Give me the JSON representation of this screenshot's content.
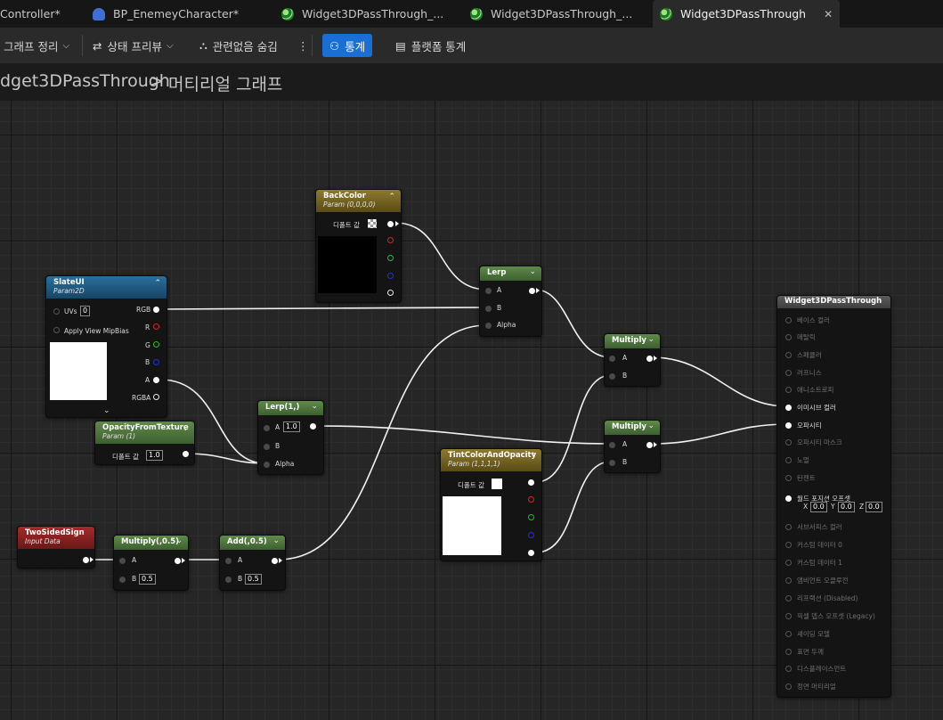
{
  "tabs": [
    {
      "label": "Controller*",
      "icon": "none"
    },
    {
      "label": "BP_EnemeyCharacter*",
      "icon": "blueprint-character-icon"
    },
    {
      "label": "Widget3DPassThrough_...",
      "icon": "material-icon"
    },
    {
      "label": "Widget3DPassThrough_...",
      "icon": "material-icon"
    },
    {
      "label": "Widget3DPassThrough",
      "icon": "material-icon",
      "active": true
    }
  ],
  "toolbar": {
    "graph_cleanup": "그래프 정리",
    "state_preview": "상태 프리뷰",
    "hide_unrelated": "관련없음 숨김",
    "stats": "통계",
    "platform_stats": "플랫폼 통계"
  },
  "breadcrumb": {
    "asset": "dget3DPassThrough",
    "separator": ">",
    "graph": "머티리얼 그래프"
  },
  "nodes": {
    "back_color": {
      "title": "BackColor",
      "subtitle": "Param (0,0,0,0)",
      "default_label": "디폴트 값"
    },
    "slate_ui": {
      "title": "SlateUI",
      "subtitle": "Param2D",
      "uvs": "UVs",
      "uvs_value": "0",
      "apply_view": "Apply View MipBias",
      "outputs": [
        "RGB",
        "R",
        "G",
        "B",
        "A",
        "RGBA"
      ]
    },
    "opacity_from_texture": {
      "title": "OpacityFromTexture",
      "subtitle": "Param (1)",
      "default_label": "디폴트 값",
      "value": "1.0"
    },
    "lerp_top": {
      "title": "Lerp",
      "inputs": [
        "A",
        "B",
        "Alpha"
      ]
    },
    "lerp_mid": {
      "title": "Lerp(1,)",
      "inputs": [
        "A",
        "B",
        "Alpha"
      ],
      "a_value": "1.0"
    },
    "multiply_top": {
      "title": "Multiply",
      "inputs": [
        "A",
        "B"
      ]
    },
    "multiply_mid": {
      "title": "Multiply",
      "inputs": [
        "A",
        "B"
      ]
    },
    "tint": {
      "title": "TintColorAndOpacity",
      "subtitle": "Param (1,1,1,1)",
      "default_label": "디폴트 값"
    },
    "two_sided": {
      "title": "TwoSidedSign",
      "subtitle": "Input Data"
    },
    "multiply_half": {
      "title": "Multiply(,0.5)",
      "inputs": [
        "A",
        "B"
      ],
      "b_value": "0.5"
    },
    "add_half": {
      "title": "Add(,0.5)",
      "inputs": [
        "A",
        "B"
      ],
      "b_value": "0.5"
    },
    "result": {
      "title": "Widget3DPassThrough",
      "pins": [
        "베이스 컬러",
        "메탈릭",
        "스페큘러",
        "러프니스",
        "애니소트로피",
        "이미시브 컬러",
        "오파시티",
        "오파시티 마스크",
        "노멀",
        "탄젠트",
        "월드 포지션 오프셋",
        "서브서피스 컬러",
        "커스텀 데이터 0",
        "커스텀 데이터 1",
        "앰비언트 오클루전",
        "리프랙션 (Disabled)",
        "픽셀 뎁스 오프셋 (Legacy)",
        "셰이딩 모델",
        "표면 두께",
        "디스플레이스먼트",
        "정면 머티리얼"
      ],
      "active_pins": [
        5,
        6,
        10
      ],
      "wpo": {
        "x_label": "X",
        "x": "0.0",
        "y_label": "Y",
        "y": "0.0",
        "z_label": "Z",
        "z": "0.0"
      }
    }
  },
  "colors": {
    "accent": "#1a6fd6",
    "param_header": "#8d7a2e",
    "texture_header": "#2a6f9c",
    "math_header": "#5f8a4a",
    "input_header": "#a52a2a"
  }
}
